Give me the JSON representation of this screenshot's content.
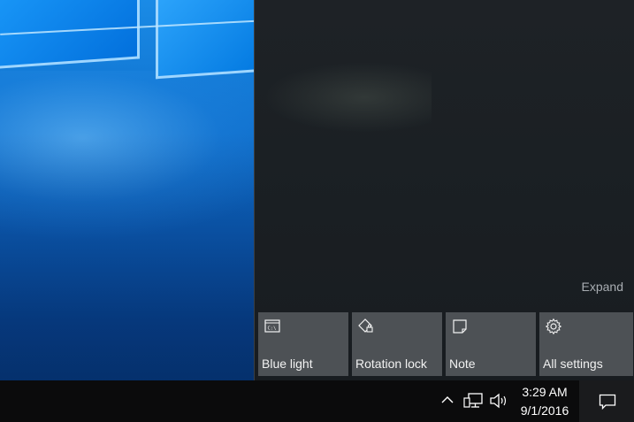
{
  "action_center": {
    "expand_label": "Expand",
    "tiles": [
      {
        "label": "Blue light",
        "icon": "blue-light-icon",
        "icon_text": "C:\\"
      },
      {
        "label": "Rotation lock",
        "icon": "rotation-lock-icon"
      },
      {
        "label": "Note",
        "icon": "note-icon"
      },
      {
        "label": "All settings",
        "icon": "gear-icon"
      }
    ]
  },
  "taskbar": {
    "clock": {
      "time": "3:29 AM",
      "date": "9/1/2016"
    },
    "tray_icons": [
      "chevron-up-icon",
      "network-icon",
      "volume-icon"
    ],
    "notification_icon": "action-center-icon"
  },
  "colors": {
    "panel_bg": "#1e2226",
    "tile_bg": "#4d5155",
    "taskbar_bg": "#0b0b0c",
    "wallpaper": "#0f6fcc"
  }
}
